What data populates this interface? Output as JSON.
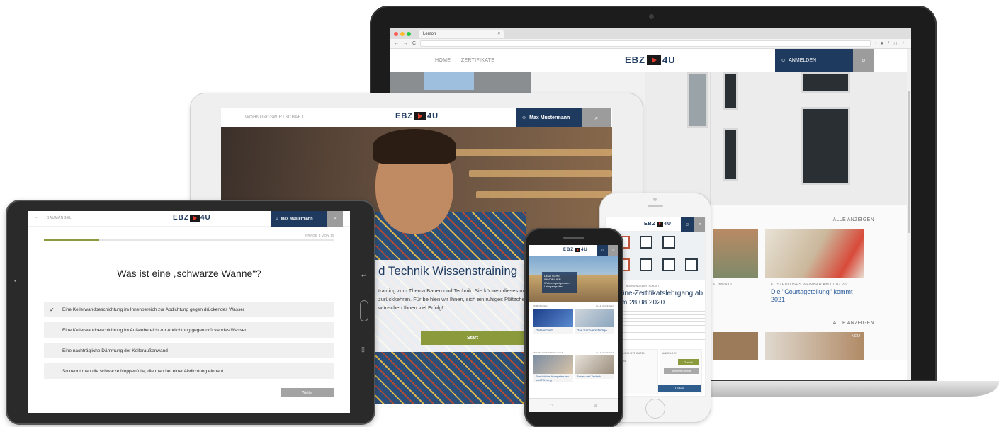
{
  "laptop": {
    "browser": {
      "tab_title": "Lemon",
      "tab_close": "×"
    },
    "header": {
      "nav_home": "HOME",
      "nav_separator": "|",
      "nav_certificates": "ZERTIFIKATE",
      "logo_left": "EBZ",
      "logo_right": "4U",
      "login_label": "ANMELDEN",
      "search_icon": "search-icon"
    },
    "sections": [
      {
        "link": "ALLE ANZEIGEN",
        "cards": [
          {
            "badge": "KOMPAKT",
            "title": ""
          },
          {
            "badge": "KOSTENLOSES WEBINAR AM 01.07.20",
            "title": "Die \"Courtageteilung\" kommt 2021"
          }
        ]
      },
      {
        "link": "ALLE ANZEIGEN",
        "cards": [
          {
            "badge": "NEU",
            "title": ""
          }
        ]
      }
    ]
  },
  "tablet_middle": {
    "back": "←",
    "section": "WOHNUNGSWIRTSCHAFT",
    "logo_left": "EBZ",
    "logo_right": "4U",
    "user": "Max Mustermann",
    "title": "d Technik Wissenstraining",
    "text": "training zum Thema Bauen und Technik. Sie können dieses und wieder zur Lehrgangs-Startseite zurückkehren. Für be hlen wir Ihnen, sich ein ruhiges Plätzchen zu suchen und chalten. Wir wünschen Ihnen viel Erfolg!",
    "start_label": "Start"
  },
  "tablet_left": {
    "back": "←",
    "section": "BAUMÄNGEL",
    "logo_left": "EBZ",
    "logo_right": "4U",
    "user": "Max Mustermann",
    "progress_label": "FRAGE 8 VON 15",
    "progress_fraction": 0.19,
    "question": "Was ist eine „schwarze Wanne“?",
    "options": [
      {
        "text": "Eine Kellerwandbeschichtung im Innenbereich zur Abdichtung gegen drückendes Wasser",
        "checked": true
      },
      {
        "text": "Eine Kellerwandbeschichtung im Außenbereich zur Abdichtung gegen drückendes Wasser",
        "checked": false
      },
      {
        "text": "Eine nachträgliche Dämmung der Kelleraußenwand",
        "checked": false
      },
      {
        "text": "So nennt man die schwarze Noppenfolie, die man bei einer Abdichtung einbaut",
        "checked": false
      }
    ],
    "check_mark": "✓",
    "next_label": "Weiter"
  },
  "phone_white": {
    "logo_left": "EBZ",
    "logo_right": "4U",
    "badge": "WOHNUNGSWIRTSCHAFT",
    "title": "line-Zertifikatslehrgang ab m 28.08.2020",
    "box1_label": "NÄCHSTE DATEN",
    "box2_label": "ANMELDEN",
    "box1_value": "28.",
    "green_label": "Zurück",
    "grey_label": "Weitere Details",
    "blue_label": "Laden"
  },
  "phone_black": {
    "logo_left": "EBZ",
    "logo_right": "4U",
    "hero_text": "DEUTSCHE IMMOBILIEN Wohnungseigentum Lehrgangsstart",
    "sections": [
      {
        "label": "IMMOBILIEN",
        "more": "ALLE ANZEIGEN",
        "cards": [
          "Datenschutz",
          "Das Sachverständige..."
        ]
      },
      {
        "label": "WOHNUNGSWIRTSCHAFT",
        "more": "ALLE ANZEIGEN",
        "cards": [
          "Persönliche Kompetenzen und Führung",
          "Bauen und Technik"
        ]
      }
    ]
  },
  "colors": {
    "navy": "#1e3a5f",
    "olive": "#8b9a3a",
    "grey_button": "#9c9c9c",
    "logo_red": "#e03a2b"
  }
}
